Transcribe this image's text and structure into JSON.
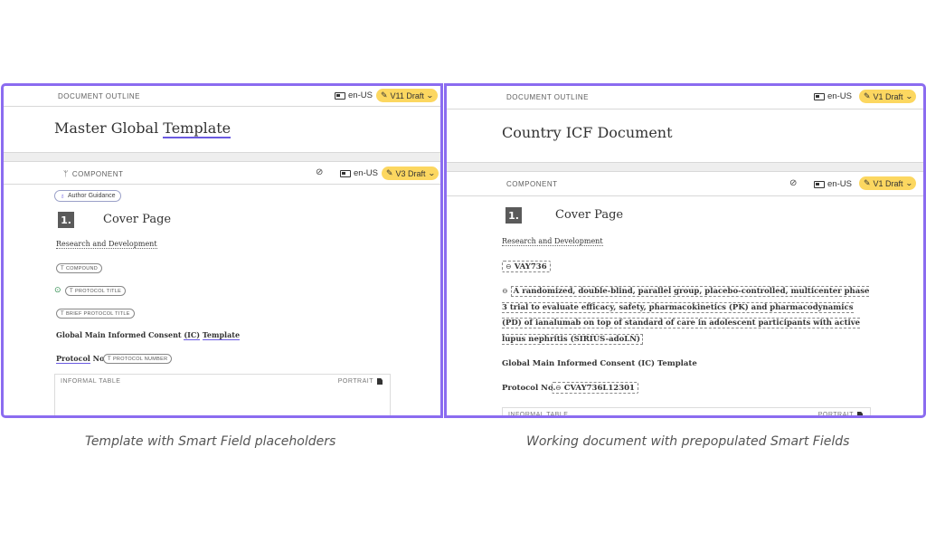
{
  "left": {
    "outline_label": "DOCUMENT OUTLINE",
    "lang": "en-US",
    "version": "V11 Draft",
    "title_a": "Master Global ",
    "title_b": "Template",
    "component_label": "COMPONENT",
    "component_lang": "en-US",
    "component_version": "V3 Draft",
    "author_guidance": "Author Guidance",
    "section_number": "1.",
    "section_title": "Cover Page",
    "org_text": "Research and Development",
    "chip_compound": "COMPOUND",
    "chip_protocol_title": "PROTOCOL TITLE",
    "chip_brief_title": "BRIEF PROTOCOL TITLE",
    "consent_a": "Global Main Informed Consent ",
    "consent_b": "(IC)",
    "consent_c": " ",
    "consent_d": "Template",
    "protocol_prefix_a": "Protocol",
    "protocol_prefix_b": " No.",
    "chip_protocol_number": "PROTOCOL NUMBER",
    "table_label": "INFORMAL TABLE",
    "table_orientation": "PORTRAIT"
  },
  "right": {
    "outline_label": "DOCUMENT OUTLINE",
    "lang": "en-US",
    "version": "V1 Draft",
    "title": "Country ICF Document",
    "component_label": "COMPONENT",
    "component_lang": "en-US",
    "component_version": "V1 Draft",
    "section_number": "1.",
    "section_title": "Cover Page",
    "org_text": "Research and Development",
    "compound_value": "VAY736",
    "protocol_title_value": "A randomized, double-blind, parallel group, placebo-controlled, multicenter phase 3 trial to evaluate efficacy, safety, pharmacokinetics (PK) and pharmacodynamics (PD) of ianalumab on top of standard of care in adolescent participants with active lupus nephritis (SIRIUS-adoLN)",
    "consent_text": "Global Main Informed Consent (IC) Template",
    "protocol_prefix": "Protocol No.",
    "protocol_number_value": "CVAY736L12301",
    "table_label": "INFORMAL TABLE",
    "table_orientation": "PORTRAIT"
  },
  "captions": {
    "left": "Template with Smart Field placeholders",
    "right": "Working document with prepopulated Smart Fields"
  },
  "colors": {
    "frame": "#8b6cf0",
    "badge": "#fcd760",
    "underline": "#6a5ae0"
  },
  "icons": [
    "language-icon",
    "edit-icon",
    "chevron-down-icon",
    "branch-icon",
    "eye-off-icon",
    "lightbulb-icon",
    "text-field-icon",
    "check-circle-icon",
    "link-icon",
    "page-icon"
  ]
}
